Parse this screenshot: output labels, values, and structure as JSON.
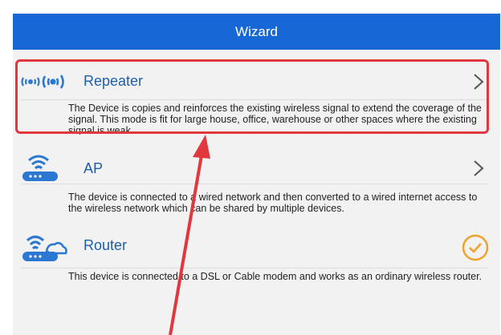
{
  "header": {
    "title": "Wizard"
  },
  "modes": [
    {
      "label": "Repeater",
      "description": "The Device is copies and reinforces the existing wireless signal to extend the coverage of the signal. This mode is fit for large house, office, warehouse or other spaces where the existing signal is weak.",
      "icon": "wifi-signal-icon",
      "action_icon": "chevron-right-icon"
    },
    {
      "label": "AP",
      "description": "The device is connected to a wired network and then converted to a wired internet access to the wireless network which can be shared by multiple devices.",
      "icon": "wifi-router-icon",
      "action_icon": "chevron-right-icon"
    },
    {
      "label": "Router",
      "description": "This device is connected to a DSL or Cable modem and works as an ordinary wireless router.",
      "icon": "cloud-router-icon",
      "action_icon": "checkmark-circle-icon",
      "selected": true
    }
  ],
  "colors": {
    "header": "#1768d6",
    "title": "#1f5fa8",
    "icon": "#2a78d2",
    "check": "#f0a22a",
    "highlight": "#e0383e"
  }
}
